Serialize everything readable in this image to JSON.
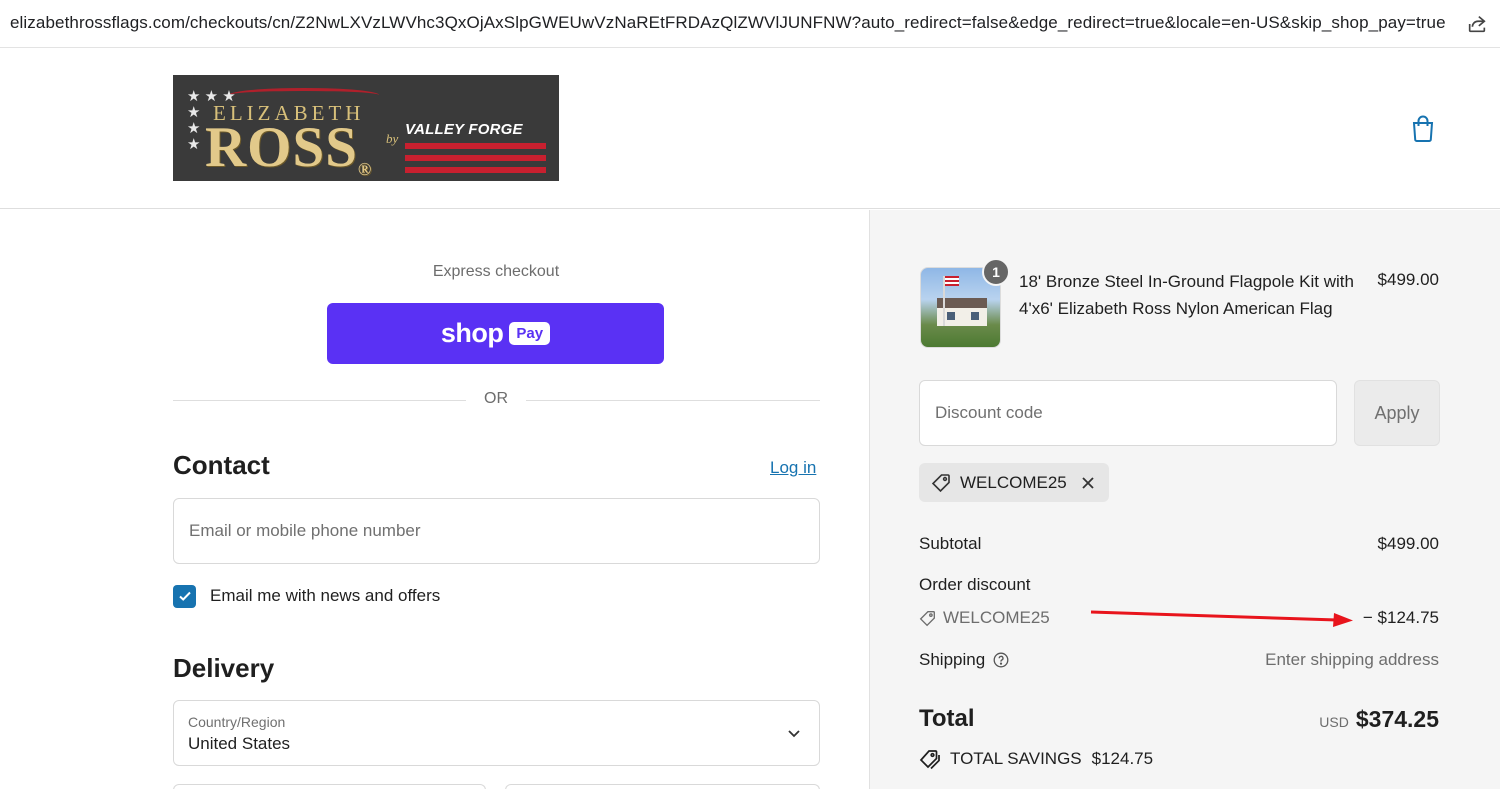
{
  "browser": {
    "url": "elizabethrossflags.com/checkouts/cn/Z2NwLXVzLWVhc3QxOjAxSlpGWEUwVzNaREtFRDAzQlZWVlJUNFNW?auto_redirect=false&edge_redirect=true&locale=en-US&skip_shop_pay=true"
  },
  "brand": {
    "logo_word_top": "ELIZABETH",
    "logo_word_main": "ROSS",
    "logo_reg": "®",
    "logo_by": "by",
    "logo_partner": "VALLEY FORGE"
  },
  "express": {
    "title": "Express checkout",
    "shop_label": "shop",
    "pay_label": "Pay",
    "or_label": "OR"
  },
  "contact": {
    "title": "Contact",
    "login_label": "Log in",
    "email_placeholder": "Email or mobile phone number",
    "newsletter_label": "Email me with news and offers",
    "newsletter_checked": true
  },
  "delivery": {
    "title": "Delivery",
    "country_label": "Country/Region",
    "country_value": "United States"
  },
  "summary": {
    "product": {
      "quantity": "1",
      "name": "18' Bronze Steel In-Ground Flagpole Kit with 4'x6' Elizabeth Ross Nylon American Flag",
      "price": "$499.00"
    },
    "discount_placeholder": "Discount code",
    "apply_label": "Apply",
    "applied_code": "WELCOME25",
    "subtotal_label": "Subtotal",
    "subtotal_value": "$499.00",
    "order_discount_label": "Order discount",
    "order_discount_code": "WELCOME25",
    "order_discount_value": "− $124.75",
    "shipping_label": "Shipping",
    "shipping_value": "Enter shipping address",
    "total_label": "Total",
    "total_currency": "USD",
    "total_value": "$374.25",
    "savings_label": "TOTAL SAVINGS",
    "savings_value": "$124.75"
  },
  "colors": {
    "shop_pay": "#5a31f4",
    "link": "#1773b0",
    "annotation_arrow": "#e8141c",
    "summary_bg": "#f5f5f5"
  }
}
